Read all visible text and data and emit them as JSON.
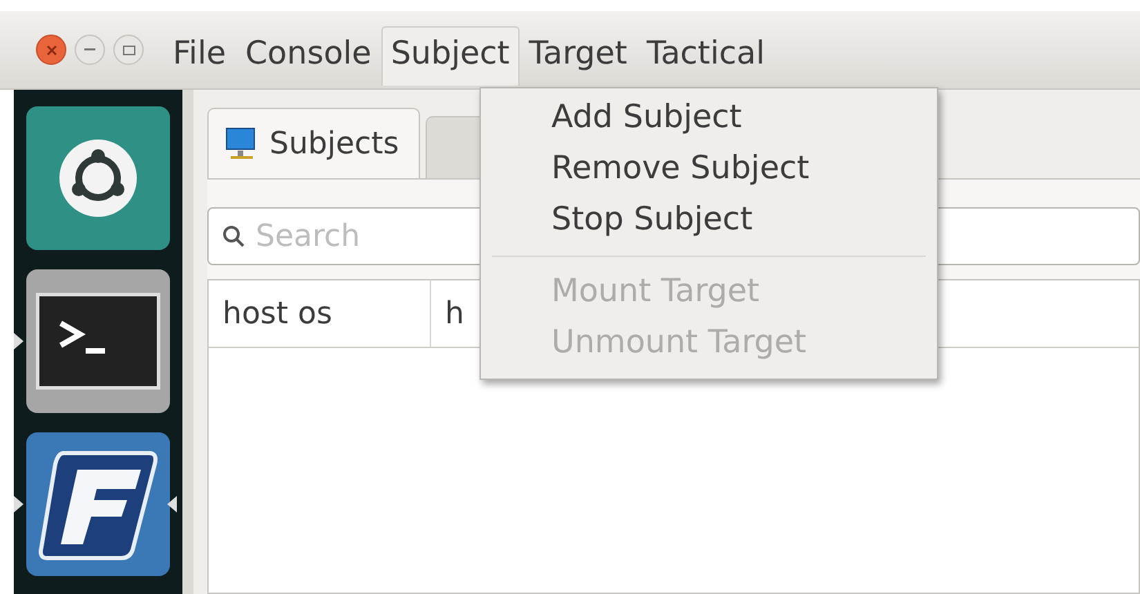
{
  "menubar": [
    {
      "label": "File",
      "selected": false
    },
    {
      "label": "Console",
      "selected": false
    },
    {
      "label": "Subject",
      "selected": true
    },
    {
      "label": "Target",
      "selected": false
    },
    {
      "label": "Tactical",
      "selected": false
    }
  ],
  "launcher": [
    {
      "kind": "ubuntu",
      "running": false,
      "focused": false
    },
    {
      "kind": "terminal",
      "running": true,
      "focused": false
    },
    {
      "kind": "app",
      "running": true,
      "focused": true
    }
  ],
  "tabs": [
    {
      "label": "Subjects",
      "selected": true
    }
  ],
  "search": {
    "placeholder": "Search"
  },
  "table": {
    "columns": [
      "host os",
      "h"
    ]
  },
  "menu": [
    {
      "kind": "item",
      "label": "Add Subject",
      "disabled": false
    },
    {
      "kind": "item",
      "label": "Remove Subject",
      "disabled": false
    },
    {
      "kind": "item",
      "label": "Stop Subject",
      "disabled": false
    },
    {
      "kind": "separator"
    },
    {
      "kind": "item",
      "label": "Mount Target",
      "disabled": true
    },
    {
      "kind": "item",
      "label": "Unmount Target",
      "disabled": true
    }
  ]
}
